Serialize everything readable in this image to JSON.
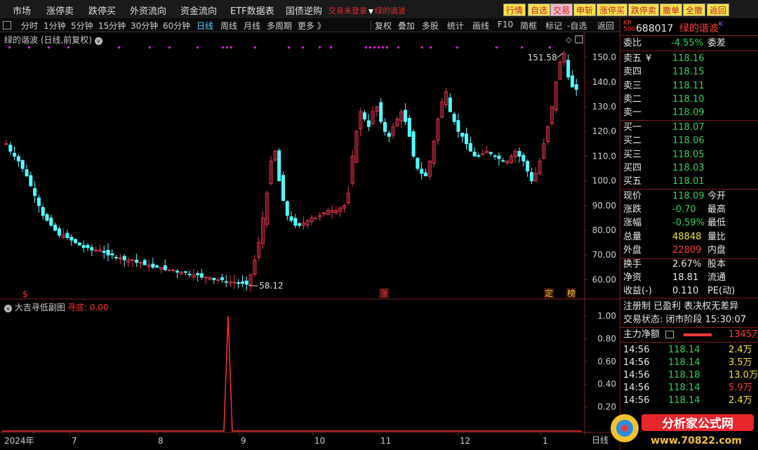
{
  "topbar": {
    "menus": [
      "市场",
      "涨停卖",
      "跌停买",
      "外资流向",
      "资金流向",
      "ETF数据表",
      "国债逆购"
    ],
    "warning": "交易未登录",
    "stock_tag": "绿的谐波",
    "buttons": [
      "行情",
      "自选",
      "交易",
      "申斩",
      "涨停买",
      "跌停卖",
      "撤单",
      "全撤",
      "返回"
    ]
  },
  "toolbar": {
    "items": [
      "分时",
      "1分钟",
      "5分钟",
      "15分钟",
      "30分钟",
      "60分钟",
      "日线",
      "周线",
      "月线",
      "多周期",
      "更多 》"
    ],
    "active": "日线",
    "right_items": [
      "复权",
      "叠加",
      "多股",
      "统计",
      "画线",
      "F10",
      "简框",
      "标记",
      "-自选",
      "返回"
    ]
  },
  "chart": {
    "title": "绿的谐波 (日线,前复权)",
    "price_axis": [
      "150.0",
      "140.0",
      "130.0",
      "120.0",
      "110.0",
      "100.0",
      "90.00",
      "80.00",
      "70.00",
      "60.00"
    ],
    "high_label": "151.58",
    "low_label": "58.12",
    "markers": [
      "涨",
      "定",
      "榜"
    ],
    "dates": [
      "2024年",
      "7",
      "8",
      "9",
      "10",
      "11",
      "12",
      "1"
    ],
    "period": "日线",
    "colors": {
      "up": "#e8364f",
      "down": "#54ffff",
      "grid": "#7a1f1f",
      "dot": "#d020d0"
    }
  },
  "chart_data": {
    "type": "candlestick",
    "title": "绿的谐波 (日线,前复权)",
    "ylim": [
      55,
      155
    ],
    "x_labels": [
      "2024年",
      "7",
      "8",
      "9",
      "10",
      "11",
      "12",
      "1"
    ],
    "close": [
      115,
      112,
      110,
      108,
      105,
      102,
      98,
      94,
      90,
      86,
      84,
      82,
      80,
      78,
      78,
      77,
      76,
      75,
      74,
      73,
      73,
      72,
      72,
      72,
      71,
      70,
      70,
      69,
      69,
      68,
      68,
      68,
      67,
      67,
      66,
      66,
      65,
      65,
      65,
      64,
      64,
      64,
      63,
      63,
      63,
      62,
      62,
      62,
      61,
      61,
      61,
      60,
      60,
      60,
      59,
      59,
      59,
      58.5,
      58.5,
      58.12,
      62,
      68,
      75,
      85,
      95,
      108,
      112,
      100,
      92,
      86,
      84,
      82,
      82,
      83,
      84,
      85,
      85,
      86,
      87,
      88,
      88,
      88,
      89,
      90,
      95,
      110,
      120,
      128,
      125,
      122,
      128,
      130,
      124,
      120,
      118,
      122,
      125,
      128,
      124,
      118,
      110,
      105,
      103,
      102,
      108,
      116,
      125,
      132,
      136,
      128,
      124,
      120,
      118,
      115,
      112,
      110,
      110,
      111,
      112,
      111,
      110,
      109,
      108,
      108,
      110,
      112,
      110,
      108,
      104,
      100,
      103,
      108,
      115,
      122,
      130,
      140,
      148,
      151.58,
      142,
      138,
      137
    ]
  },
  "sub_chart": {
    "title": "大吉寻低副图",
    "value_label": "寻底: 0.00",
    "axis": [
      "1.00",
      "0.80",
      "0.60",
      "0.40",
      "0.20"
    ]
  },
  "quote": {
    "code": "688017",
    "name": "绿的谐波",
    "badge_top": "KR",
    "badge_bottom": "500",
    "webi_label": "委比",
    "webi": "-4.55%",
    "weicha_label": "委差",
    "asks": [
      {
        "label": "卖五",
        "price": "118.16",
        "mark": "¥"
      },
      {
        "label": "卖四",
        "price": "118.15"
      },
      {
        "label": "卖三",
        "price": "118.11"
      },
      {
        "label": "卖二",
        "price": "118.10"
      },
      {
        "label": "卖一",
        "price": "118.09"
      }
    ],
    "bids": [
      {
        "label": "买一",
        "price": "118.07"
      },
      {
        "label": "买二",
        "price": "118.06"
      },
      {
        "label": "买三",
        "price": "118.05"
      },
      {
        "label": "买四",
        "price": "118.03"
      },
      {
        "label": "买五",
        "price": "118.01"
      }
    ],
    "stats": [
      {
        "label": "现价",
        "value": "118.09",
        "color": "green",
        "label2": "今开"
      },
      {
        "label": "涨跌",
        "value": "-0.70",
        "color": "green",
        "label2": "最高"
      },
      {
        "label": "涨幅",
        "value": "-0.59%",
        "color": "green",
        "label2": "最低"
      },
      {
        "label": "总量",
        "value": "48848",
        "color": "yel",
        "label2": "量比"
      },
      {
        "label": "外盘",
        "value": "22809",
        "color": "red",
        "label2": "内盘"
      }
    ],
    "stats2": [
      {
        "label": "换手",
        "value": "2.67%",
        "label2": "股本"
      },
      {
        "label": "净资",
        "value": "18.81",
        "label2": "流通"
      },
      {
        "label": "收益(-)",
        "value": "0.110",
        "label2": "PE(动)"
      }
    ],
    "reg": "注册制 已盈利 表决权无差异",
    "status": "交易状态: 闭市阶段 15:30:07",
    "net_label": "主力净额",
    "net_value": "1345万",
    "ticks": [
      {
        "time": "14:56",
        "price": "118.14",
        "vol": "2.4万",
        "c": "yel"
      },
      {
        "time": "14:56",
        "price": "118.14",
        "vol": "3.5万",
        "c": "yel"
      },
      {
        "time": "14:56",
        "price": "118.18",
        "vol": "13.0万",
        "c": "yel"
      },
      {
        "time": "14:56",
        "price": "118.14",
        "vol": "5.9万",
        "c": "red"
      },
      {
        "time": "14:56",
        "price": "118.14",
        "vol": "2.4万",
        "c": "yel"
      }
    ]
  },
  "logo": {
    "text": "分析家公式网",
    "url": "www.70822.com"
  }
}
